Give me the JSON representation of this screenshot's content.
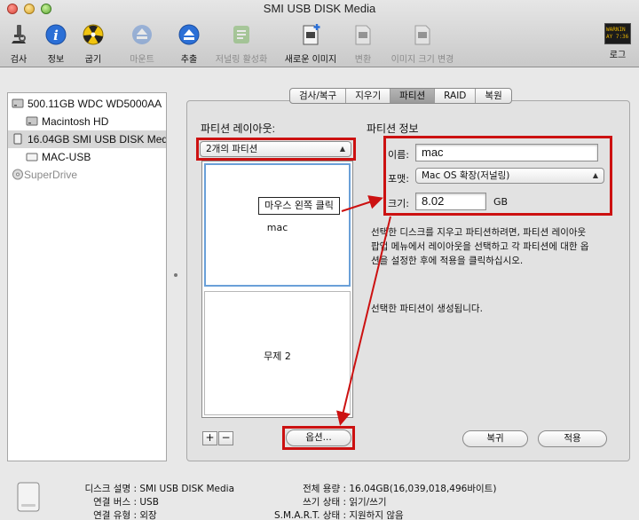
{
  "window": {
    "title": "SMI USB DISK Media"
  },
  "toolbar": {
    "items": [
      {
        "label": "검사",
        "icon": "microscope-icon",
        "enabled": true
      },
      {
        "label": "정보",
        "icon": "info-icon",
        "enabled": true
      },
      {
        "label": "굽기",
        "icon": "burn-icon",
        "enabled": true
      },
      {
        "label": "마운트",
        "icon": "mount-icon",
        "enabled": false
      },
      {
        "label": "추출",
        "icon": "eject-icon",
        "enabled": true
      },
      {
        "label": "저널링 활성화",
        "icon": "journal-icon",
        "enabled": false
      },
      {
        "label": "새로운 이미지",
        "icon": "new-image-icon",
        "enabled": true
      },
      {
        "label": "변환",
        "icon": "convert-icon",
        "enabled": false
      },
      {
        "label": "이미지 크기 변경",
        "icon": "resize-image-icon",
        "enabled": false
      },
      {
        "label": "로그",
        "icon": "log-icon",
        "enabled": true
      }
    ],
    "log_badge": "WARNIN\nAY 7:36"
  },
  "sidebar": {
    "items": [
      {
        "label": "500.11GB WDC WD5000AA",
        "kind": "disk",
        "selected": false
      },
      {
        "label": "Macintosh HD",
        "kind": "volume",
        "selected": false
      },
      {
        "label": "16.04GB SMI USB DISK Med",
        "kind": "disk",
        "selected": true
      },
      {
        "label": "MAC-USB",
        "kind": "volume",
        "selected": false
      },
      {
        "label": "SuperDrive",
        "kind": "optical",
        "selected": false
      }
    ]
  },
  "tabs": [
    "검사/복구",
    "지우기",
    "파티션",
    "RAID",
    "복원"
  ],
  "active_tab": "파티션",
  "partition": {
    "layout_title": "파티션 레이아웃:",
    "layout_value": "2개의 파티션",
    "partitions": [
      "mac",
      "무제 2"
    ],
    "annotation": "마우스 왼쪽 클릭",
    "info_title": "파티션 정보",
    "name_label": "이름:",
    "name_value": "mac",
    "format_label": "포맷:",
    "format_value": "Mac OS 확장(저널링)",
    "size_label": "크기:",
    "size_value": "8.02",
    "size_unit": "GB",
    "description": [
      "선택한 디스크를 지우고 파티션하려면, 파티션 레이아웃",
      "팝업 메뉴에서 레이아웃을 선택하고 각 파티션에 대한 옵",
      "션을 설정한 후에 적용을 클릭하십시오."
    ],
    "status": "선택한 파티션이 생성됩니다.",
    "add_label": "+",
    "remove_label": "−",
    "options_label": "옵션...",
    "revert_label": "복귀",
    "apply_label": "적용"
  },
  "info": {
    "left": [
      {
        "key": "디스크 설명 :",
        "value": "SMI USB DISK Media"
      },
      {
        "key": "연결 버스 :",
        "value": "USB"
      },
      {
        "key": "연결 유형 :",
        "value": "외장"
      }
    ],
    "right": [
      {
        "key": "전체 용량 :",
        "value": "16.04GB(16,039,018,496바이트)"
      },
      {
        "key": "쓰기 상태 :",
        "value": "읽기/쓰기"
      },
      {
        "key": "S.M.A.R.T. 상태 :",
        "value": "지원하지 않음"
      }
    ]
  },
  "colors": {
    "annotation_red": "#cc1111",
    "selection_blue": "#6aa0d8",
    "tab_active": "#a8a8a8"
  }
}
